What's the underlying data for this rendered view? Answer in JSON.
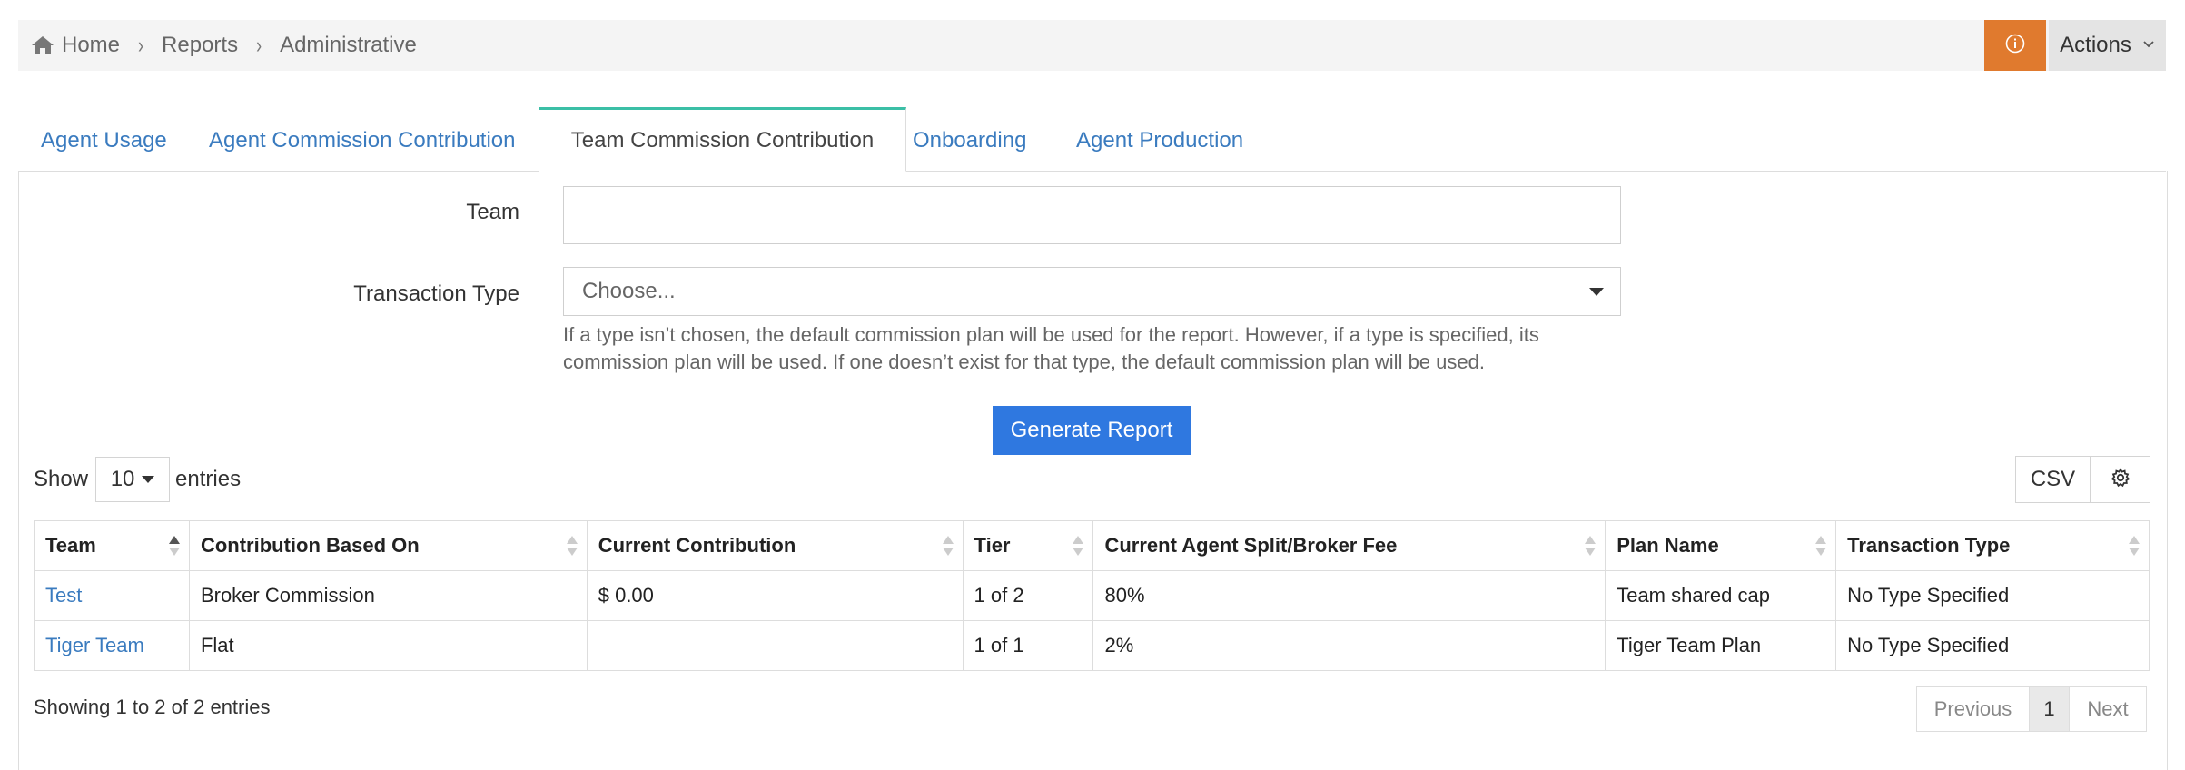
{
  "breadcrumb": {
    "items": [
      "Home",
      "Reports",
      "Administrative"
    ]
  },
  "header": {
    "actions_label": "Actions"
  },
  "tabs": [
    {
      "label": "Agent Usage",
      "active": false
    },
    {
      "label": "Agent Commission Contribution",
      "active": false
    },
    {
      "label": "Team Commission Contribution",
      "active": true
    },
    {
      "label": "Onboarding",
      "active": false
    },
    {
      "label": "Agent Production",
      "active": false
    }
  ],
  "form": {
    "team_label": "Team",
    "team_value": "",
    "type_label": "Transaction Type",
    "type_placeholder": "Choose...",
    "help_text": "If a type isn’t chosen, the default commission plan will be used for the report. However, if a type is specified, its commission plan will be used. If one doesn’t exist for that type, the default commission plan will be used.",
    "generate_label": "Generate Report"
  },
  "table_controls": {
    "show_label": "Show",
    "page_length": "10",
    "entries_label": "entries",
    "csv_label": "CSV"
  },
  "table": {
    "columns": [
      "Team",
      "Contribution Based On",
      "Current Contribution",
      "Tier",
      "Current Agent Split/Broker Fee",
      "Plan Name",
      "Transaction Type"
    ],
    "rows": [
      [
        "Test",
        "Broker Commission",
        "$ 0.00",
        "1 of 2",
        "80%",
        "Team shared cap",
        "No Type Specified"
      ],
      [
        "Tiger Team",
        "Flat",
        "",
        "1 of 1",
        "2%",
        "Tiger Team Plan",
        "No Type Specified"
      ]
    ]
  },
  "footer": {
    "info": "Showing 1 to 2 of 2 entries",
    "prev_label": "Previous",
    "current_page": "1",
    "next_label": "Next"
  },
  "colors": {
    "accent_orange": "#e07a2e",
    "primary_blue": "#2f78e0",
    "link_blue": "#3a7bbf",
    "active_tab_border": "#3bbfa6"
  }
}
